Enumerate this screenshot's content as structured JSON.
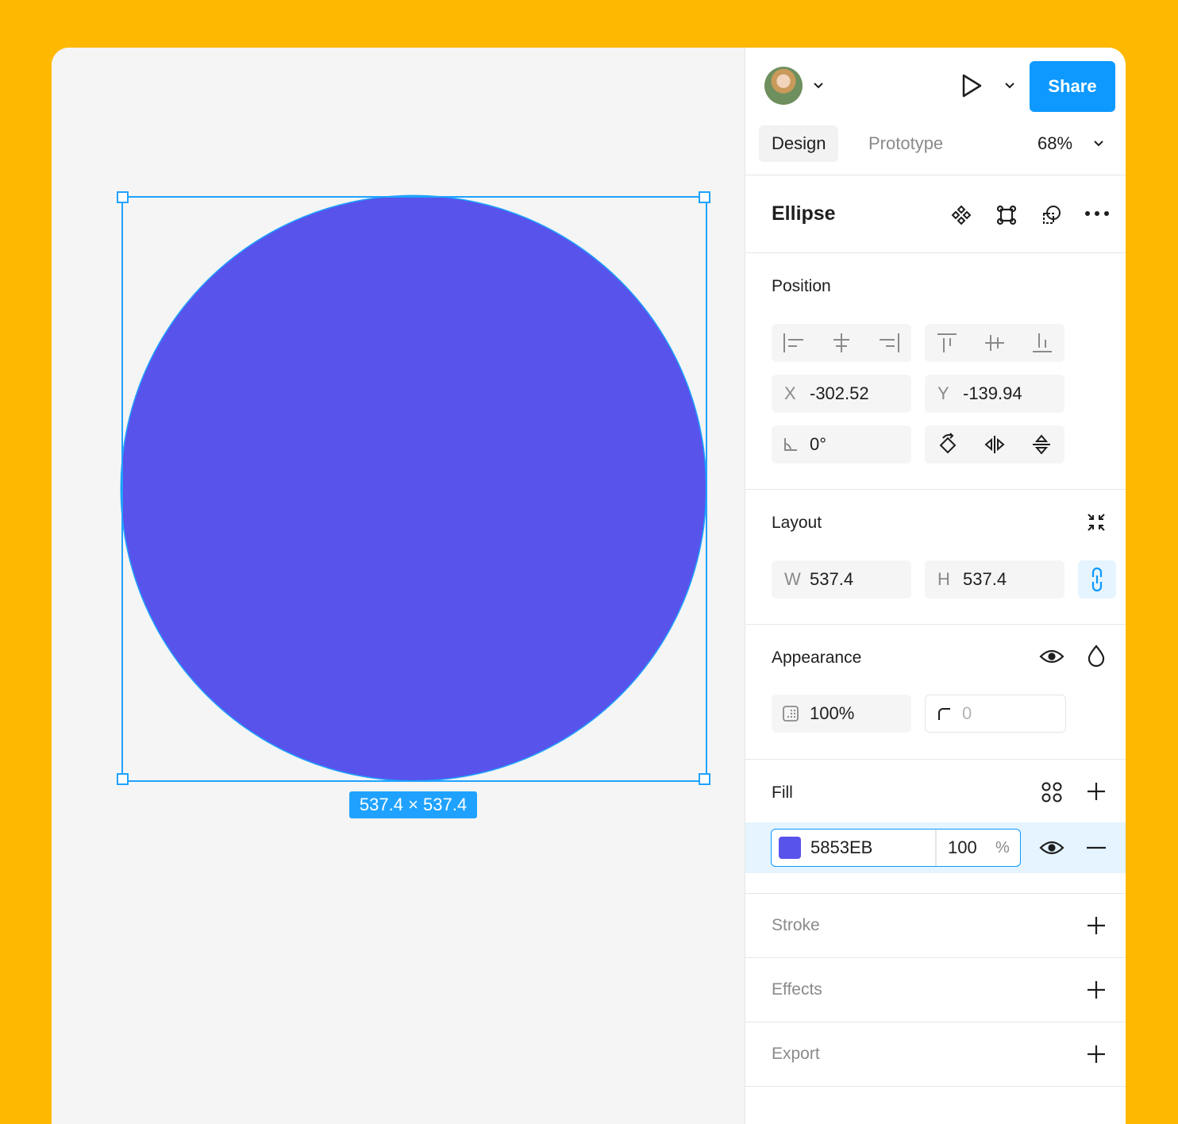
{
  "canvas": {
    "selection_size_label": "537.4 × 537.4",
    "ellipse_color": "#5853EB",
    "selection_color": "#1FA2FF"
  },
  "header": {
    "share_label": "Share",
    "avatar_icon": "user-avatar",
    "play_icon": "play-icon"
  },
  "tabs": {
    "design": "Design",
    "prototype": "Prototype",
    "zoom": "68%"
  },
  "layer": {
    "title": "Ellipse"
  },
  "position": {
    "title": "Position",
    "x_label": "X",
    "x_value": "-302.52",
    "y_label": "Y",
    "y_value": "-139.94",
    "rotation_value": "0°"
  },
  "layout": {
    "title": "Layout",
    "w_label": "W",
    "w_value": "537.4",
    "h_label": "H",
    "h_value": "537.4"
  },
  "appearance": {
    "title": "Appearance",
    "opacity": "100%",
    "corner_radius": "0"
  },
  "fill": {
    "title": "Fill",
    "hex": "5853EB",
    "opacity": "100",
    "percent": "%",
    "swatch_color": "#5853EB"
  },
  "stroke": {
    "title": "Stroke"
  },
  "effects": {
    "title": "Effects"
  },
  "export": {
    "title": "Export"
  },
  "colors": {
    "accent": "#0D99FF",
    "background": "#FFB800"
  }
}
